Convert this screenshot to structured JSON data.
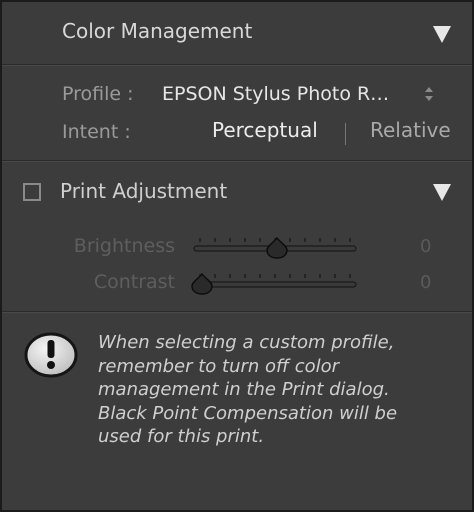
{
  "color_management": {
    "title": "Color Management",
    "profile_label": "Profile :",
    "profile_value": "EPSON Stylus Photo R…",
    "intent_label": "Intent :",
    "intent_options": [
      "Perceptual",
      "Relative"
    ],
    "selected_intent": "Perceptual"
  },
  "print_adjustment": {
    "title": "Print Adjustment",
    "enabled": false,
    "brightness": {
      "label": "Brightness",
      "value": "0",
      "level": 0.5
    },
    "contrast": {
      "label": "Contrast",
      "value": "0",
      "level": 0.0
    }
  },
  "warning": {
    "icon": "exclamation-icon",
    "text": "When selecting a custom profile, remember to turn off color management in the Print dialog. Black Point Compensation will be used for this print."
  },
  "colors": {
    "panel_bg": "#3c3c3c",
    "text_bright": "#e6e6e6",
    "text_muted": "#9a9a9a",
    "text_disabled": "#5e5e5e"
  }
}
